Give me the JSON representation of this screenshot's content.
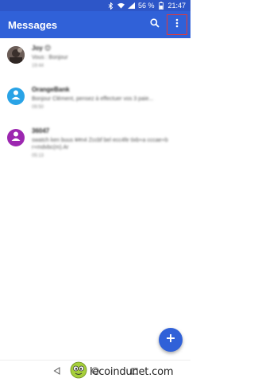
{
  "status_bar": {
    "battery_percent": "56 %",
    "time": "21:47",
    "icons": [
      "bluetooth-icon",
      "wifi-icon",
      "signal-icon",
      "battery-icon"
    ]
  },
  "app_bar": {
    "title": "Messages",
    "actions": [
      "search-icon",
      "more-vert-icon"
    ]
  },
  "conversations": [
    {
      "name": "Joy 😊",
      "snippet": "Vous : Bonjour",
      "time": "19:44",
      "avatar_color": "#5a4e4a",
      "avatar_type": "photo"
    },
    {
      "name": "OrangeBank",
      "snippet": "Bonjour Clément, pensez à effectuer vos 3 paie...",
      "time": "09:50",
      "avatar_color": "#29a3e6",
      "avatar_type": "person-icon"
    },
    {
      "name": "36047",
      "snippet": "swatch ken buus ¥#n4 Zccbf bel ecc4fe tixb+a cccae+b r+mdvbc(m).Ar",
      "time": "05:13",
      "avatar_color": "#9c27b0",
      "avatar_type": "person-icon"
    }
  ],
  "fab": {
    "icon": "add-icon",
    "color": "#3061d8"
  },
  "nav_bar": {
    "buttons": [
      "back-icon",
      "home-icon",
      "recents-icon"
    ]
  },
  "watermark": {
    "text": "lecoindunet.com"
  },
  "colors": {
    "primary": "#3061d8",
    "status_bar": "#2d56c8",
    "highlight": "#e53935"
  }
}
